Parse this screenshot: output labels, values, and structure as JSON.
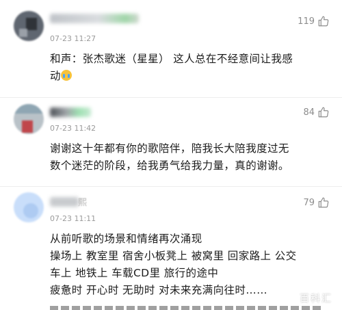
{
  "comments": [
    {
      "time": "07-23 11:27",
      "likes": "119",
      "lines": [
        "和声：张杰歌迷（星星） 这人总在不经意间让我感",
        "动"
      ],
      "emoji": "crying-face"
    },
    {
      "time": "07-23 11:42",
      "likes": "84",
      "lines": [
        "谢谢这十年都有你的歌陪伴，陪我长大陪我度过无",
        "数个迷茫的阶段，给我勇气给我力量，真的谢谢。"
      ]
    },
    {
      "time": "07-23 11:11",
      "likes": "79",
      "name_fragment": "熙",
      "lines": [
        "从前听歌的场景和情绪再次涌现",
        "操场上 教室里 宿舍小板凳上 被窝里 回家路上 公交",
        "车上 地铁上 车载CD里 旅行的途中",
        "疲惫时 开心时 无助时 对未来充满向往时……"
      ]
    }
  ],
  "watermark": "百科汇",
  "colors": {
    "text": "#1c1c1c",
    "meta": "#9a9a9a",
    "likes": "#8c8c8c"
  }
}
